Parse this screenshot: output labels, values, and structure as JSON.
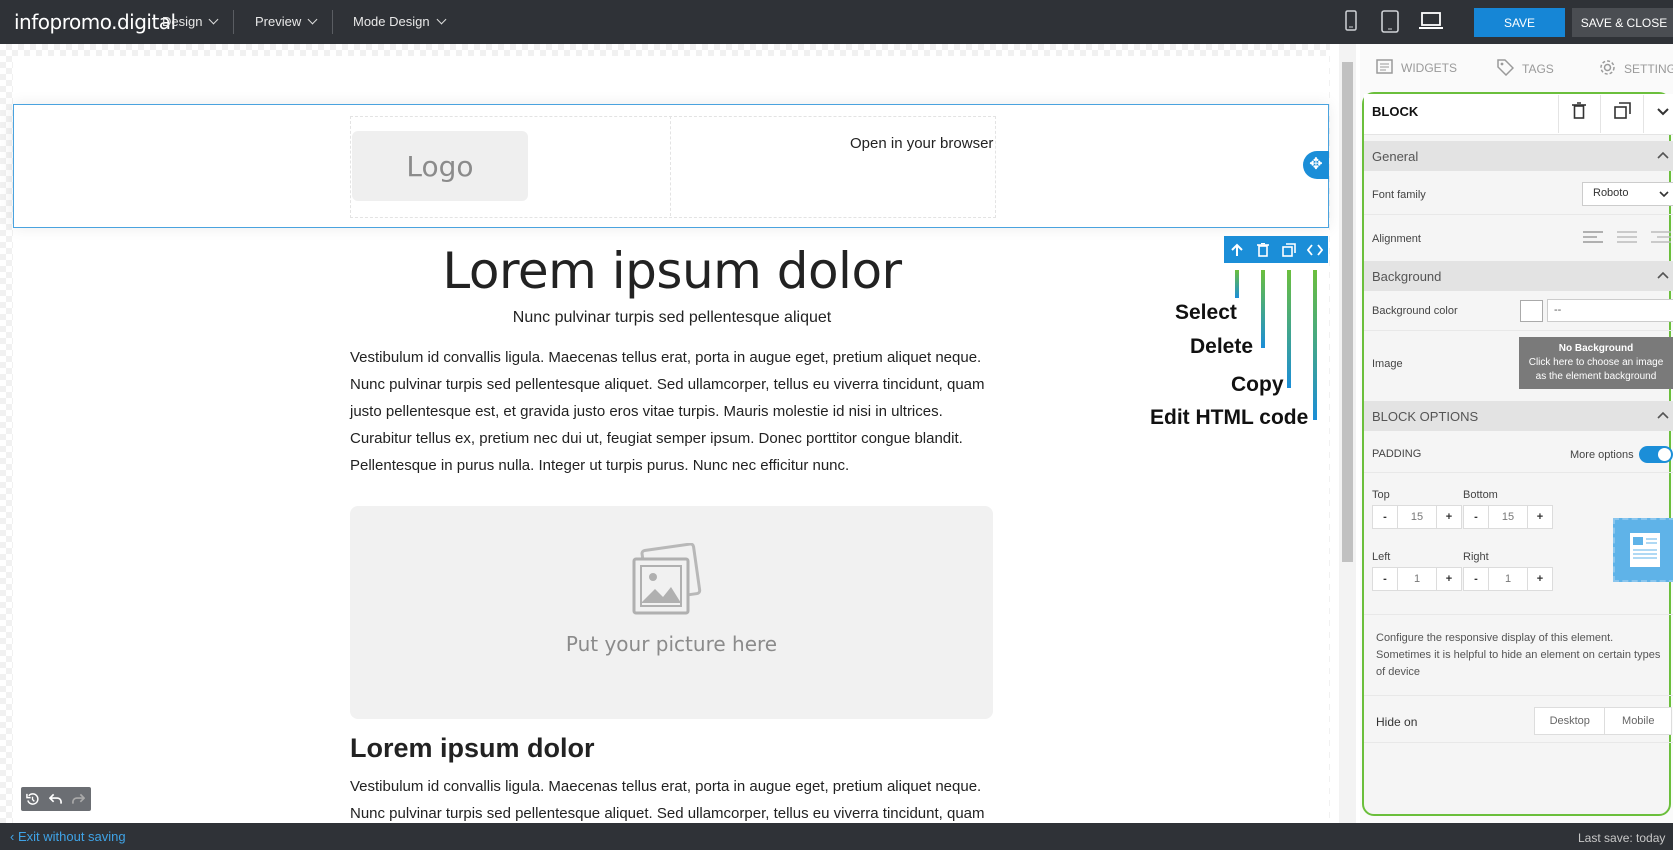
{
  "topbar": {
    "brand": "infopromo.digital",
    "menus": [
      "Design",
      "Preview",
      "Mode Design"
    ],
    "save_label": "SAVE",
    "save_close_label": "SAVE & CLOSE",
    "devices": [
      "mobile-icon",
      "tablet-icon",
      "desktop-icon"
    ]
  },
  "email": {
    "logo_text": "Logo",
    "open_browser": "Open in your browser",
    "heading": "Lorem ipsum dolor",
    "subheading": "Nunc pulvinar turpis sed pellentesque aliquet",
    "para1_lines": [
      "Vestibulum id convallis ligula. Maecenas tellus erat, porta in augue eget, pretium aliquet neque.",
      "Nunc pulvinar turpis sed pellentesque aliquet. Sed ullamcorper, tellus eu viverra tincidunt, quam",
      "justo pellentesque est, et gravida justo eros vitae turpis. Mauris molestie id nisi in ultrices.",
      "Curabitur tellus ex, pretium nec dui ut, feugiat semper ipsum. Donec porttitor congue blandit.",
      "Pellentesque in purus nulla. Integer ut turpis purus. Nunc nec efficitur nunc."
    ],
    "picture_text": "Put your picture here",
    "heading2": "Lorem ipsum dolor",
    "para2_lines": [
      "Vestibulum id convallis ligula. Maecenas tellus erat, porta in augue eget, pretium aliquet neque.",
      "Nunc pulvinar turpis sed pellentesque aliquet. Sed ullamcorper, tellus eu viverra tincidunt, quam"
    ]
  },
  "annotations": {
    "select": "Select",
    "delete": "Delete",
    "copy": "Copy",
    "edit_html": "Edit HTML code"
  },
  "panel": {
    "tabs": [
      "WIDGETS",
      "TAGS",
      "SETTING"
    ],
    "block_title": "BLOCK",
    "general": "General",
    "font_family_label": "Font family",
    "font_family_value": "Roboto",
    "alignment_label": "Alignment",
    "background": "Background",
    "bg_color_label": "Background color",
    "bg_color_value": "--",
    "image_label": "Image",
    "no_bg_title": "No Background",
    "no_bg_hint": "Click here to choose an image as the element background",
    "block_options": "BLOCK OPTIONS",
    "padding_label": "PADDING",
    "more_options": "More options",
    "top_label": "Top",
    "top_value": "15",
    "bottom_label": "Bottom",
    "bottom_value": "15",
    "left_label": "Left",
    "left_value": "1",
    "right_label": "Right",
    "right_value": "1",
    "minus": "-",
    "plus": "+",
    "responsive_text": "Configure the responsive display of this element. Sometimes it is helpful to hide an element on certain types of device",
    "hide_on_label": "Hide on",
    "desktop": "Desktop",
    "mobile": "Mobile"
  },
  "footer": {
    "exit": "Exit without saving",
    "last_save": "Last save: today"
  },
  "colors": {
    "accent": "#1b8ed8",
    "annotation_green": "#6bbf3c",
    "topbar": "#2f3237"
  }
}
